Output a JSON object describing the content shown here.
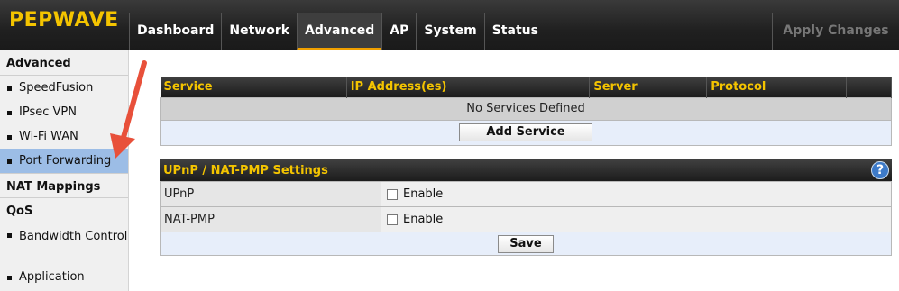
{
  "brand": {
    "logo": "PEPWAVE"
  },
  "nav": {
    "items": [
      "Dashboard",
      "Network",
      "Advanced",
      "AP",
      "System",
      "Status"
    ],
    "active": "Advanced",
    "apply_label": "Apply Changes"
  },
  "sidebar": {
    "advanced_header": "Advanced",
    "advanced_items": [
      "SpeedFusion",
      "IPsec VPN",
      "Wi-Fi WAN",
      "Port Forwarding"
    ],
    "active_item": "Port Forwarding",
    "nat_header": "NAT Mappings",
    "qos_header": "QoS",
    "qos_items": [
      "Bandwidth Control",
      "Application"
    ]
  },
  "services": {
    "columns": [
      "Service",
      "IP Address(es)",
      "Server",
      "Protocol"
    ],
    "empty_message": "No Services Defined",
    "add_button": "Add Service"
  },
  "upnp": {
    "title": "UPnP / NAT-PMP Settings",
    "help_icon": "?",
    "rows": [
      {
        "label": "UPnP",
        "option": "Enable",
        "checked": false
      },
      {
        "label": "NAT-PMP",
        "option": "Enable",
        "checked": false
      }
    ],
    "save_button": "Save"
  },
  "colors": {
    "brand": "#f4c400",
    "active_tab": "#f0a000",
    "sidebar_active": "#9cbde6",
    "arrow": "#e8503a"
  }
}
